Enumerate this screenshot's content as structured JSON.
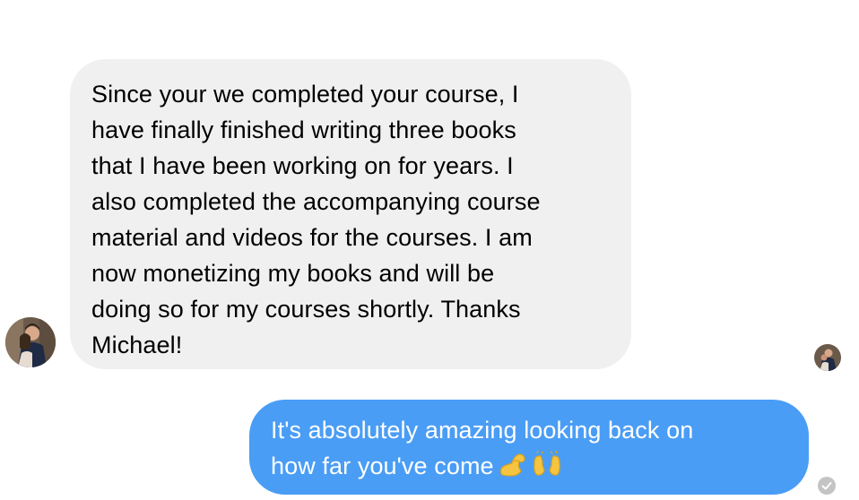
{
  "conversation": {
    "incoming_message": {
      "lines": [
        "Since your we completed your course, I",
        "have finally finished writing three books",
        "that I have been working on for years. I",
        "also completed the accompanying course",
        "material and videos for the courses. I am",
        "now monetizing my books and will be",
        "doing so for my courses shortly. Thanks",
        "Michael!"
      ],
      "avatar_icon": "user-photo-avatar"
    },
    "outgoing_message": {
      "lines": [
        "It's absolutely amazing looking back on",
        "how far you've come"
      ],
      "emojis": [
        "flexed-biceps-emoji",
        "raising-hands-emoji"
      ],
      "status_icon": "delivered-check-icon"
    },
    "read_receipt_icon": "seen-avatar-icon",
    "colors": {
      "incoming_bubble": "#f0f0f0",
      "outgoing_bubble": "#4a9df5",
      "outgoing_text": "#ffffff",
      "status_icon": "#c4c4c4"
    }
  }
}
